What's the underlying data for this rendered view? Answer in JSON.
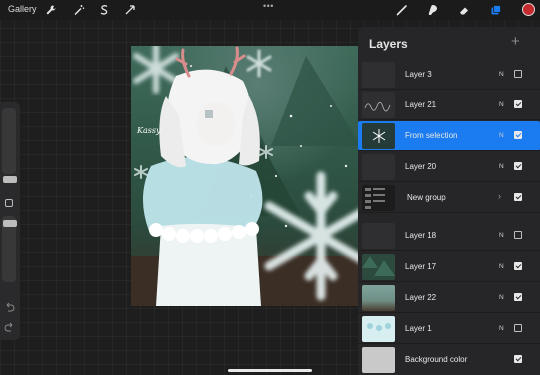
{
  "app": {
    "gallery_label": "Gallery",
    "more_icon": "ellipsis-icon",
    "accent": "#1a7cf0",
    "current_color": "#c42a2e"
  },
  "toolbar_left": [
    "wrench-icon",
    "magic-wand-icon",
    "selection-s-icon",
    "transform-arrow-icon"
  ],
  "toolbar_right": [
    "brush-icon",
    "smudge-icon",
    "eraser-icon",
    "layers-icon",
    "color-swatch"
  ],
  "canvas": {
    "signature": "Kassy"
  },
  "layers": {
    "title": "Layers",
    "add_icon": "plus-icon",
    "items": [
      {
        "name": "Layer 3",
        "blend": "N",
        "visible": false,
        "selected": false
      },
      {
        "name": "Layer 21",
        "blend": "N",
        "visible": true,
        "selected": false
      },
      {
        "name": "From selection",
        "blend": "N",
        "visible": true,
        "selected": true
      },
      {
        "name": "Layer 20",
        "blend": "N",
        "visible": true,
        "selected": false
      },
      {
        "name": "New group",
        "blend": "",
        "visible": true,
        "selected": false,
        "group": true
      },
      {
        "name": "Layer 18",
        "blend": "N",
        "visible": false,
        "selected": false
      },
      {
        "name": "Layer 17",
        "blend": "N",
        "visible": true,
        "selected": false
      },
      {
        "name": "Layer 22",
        "blend": "N",
        "visible": true,
        "selected": false
      },
      {
        "name": "Layer 1",
        "blend": "N",
        "visible": false,
        "selected": false
      },
      {
        "name": "Background color",
        "blend": "",
        "visible": true,
        "selected": false
      }
    ]
  }
}
